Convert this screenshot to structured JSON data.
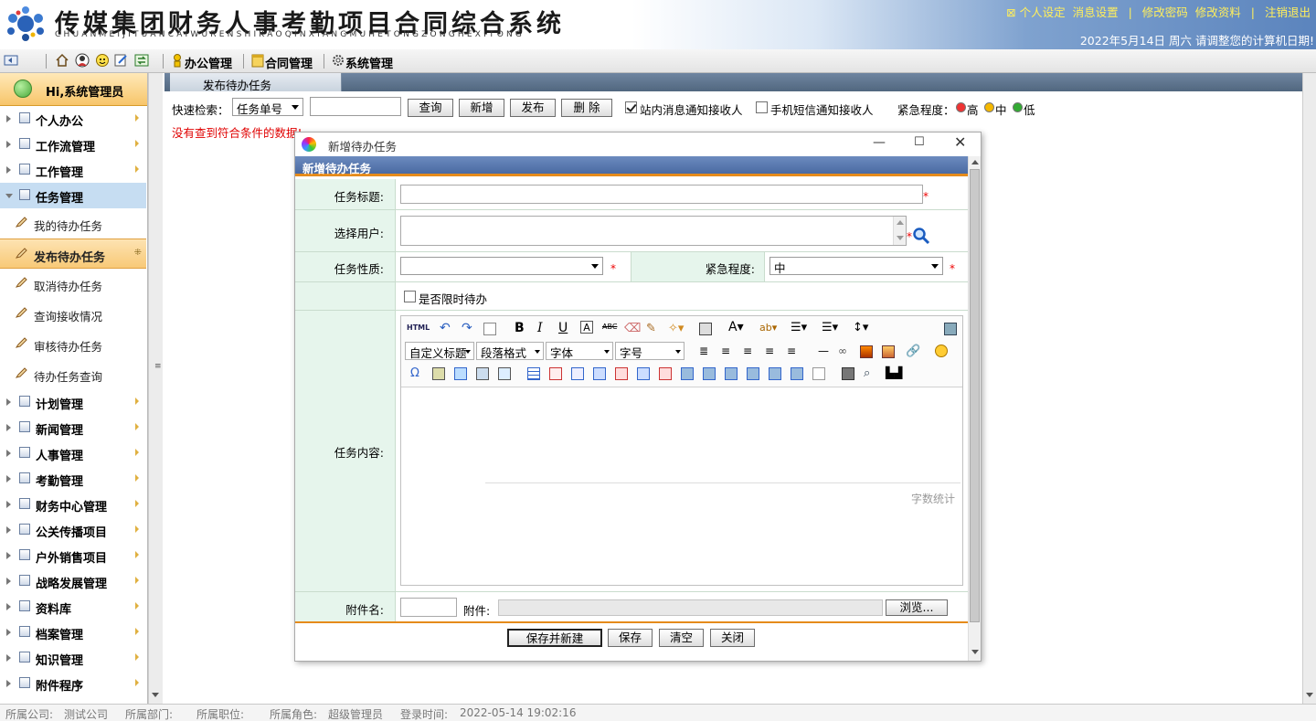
{
  "header": {
    "title": "传媒集团财务人事考勤项目合同综合系统",
    "pinyin": "CHUANMEIJITUANCAIWURENSHIKAOQINXIANGMUHETONGZONGHEXITONG",
    "links": [
      "个人设定",
      "消息设置",
      "修改密码",
      "修改资料",
      "注销退出"
    ],
    "date_line": "2022年5月14日  周六    请调整您的计算机日期!"
  },
  "toolbar": {
    "menus": [
      "办公管理",
      "合同管理",
      "系统管理"
    ]
  },
  "sidebar": {
    "greeting": "Hi,系统管理员",
    "items": [
      {
        "label": "个人办公",
        "type": "group"
      },
      {
        "label": "工作流管理",
        "type": "group"
      },
      {
        "label": "工作管理",
        "type": "group"
      },
      {
        "label": "任务管理",
        "type": "group-open"
      },
      {
        "label": "我的待办任务",
        "type": "sub"
      },
      {
        "label": "发布待办任务",
        "type": "sub-active"
      },
      {
        "label": "取消待办任务",
        "type": "sub"
      },
      {
        "label": "查询接收情况",
        "type": "sub"
      },
      {
        "label": "审核待办任务",
        "type": "sub"
      },
      {
        "label": "待办任务查询",
        "type": "sub"
      },
      {
        "label": "计划管理",
        "type": "group"
      },
      {
        "label": "新闻管理",
        "type": "group"
      },
      {
        "label": "人事管理",
        "type": "group"
      },
      {
        "label": "考勤管理",
        "type": "group"
      },
      {
        "label": "财务中心管理",
        "type": "group"
      },
      {
        "label": "公关传播项目",
        "type": "group"
      },
      {
        "label": "户外销售项目",
        "type": "group"
      },
      {
        "label": "战略发展管理",
        "type": "group"
      },
      {
        "label": "资料库",
        "type": "group"
      },
      {
        "label": "档案管理",
        "type": "group"
      },
      {
        "label": "知识管理",
        "type": "group"
      },
      {
        "label": "附件程序",
        "type": "group"
      }
    ]
  },
  "content": {
    "tab_title": "发布待办任务",
    "search_label": "快速检索：",
    "search_field": "任务单号",
    "search_value": "",
    "buttons": {
      "query": "查询",
      "add": "新增",
      "publish": "发布",
      "delete": "删 除"
    },
    "notify_internal": "站内消息通知接收人",
    "notify_sms": "手机短信通知接收人",
    "urgency_label": "紧急程度：",
    "urgency_levels": [
      {
        "label": "高",
        "color": "#ee3333"
      },
      {
        "label": "中",
        "color": "#f5b800"
      },
      {
        "label": "低",
        "color": "#33aa33"
      }
    ],
    "no_data": "没有查到符合条件的数据!"
  },
  "dialog": {
    "window_title": "新增待办任务",
    "form_title": "新增待办任务",
    "task_title_label": "任务标题:",
    "task_title_value": "",
    "user_label": "选择用户:",
    "nature_label": "任务性质:",
    "nature_value": "",
    "urgency_label": "紧急程度:",
    "urgency_value": "中",
    "limited_label": "是否限时待办",
    "content_label": "任务内容:",
    "editor": {
      "custom_title": "自定义标题",
      "paragraph": "段落格式",
      "font": "字体",
      "size": "字号",
      "word_count": "字数统计"
    },
    "attach_name_label": "附件名:",
    "attach_label": "附件:",
    "browse": "浏览...",
    "buttons": {
      "save_new": "保存并新建",
      "save": "保存",
      "clear": "清空",
      "close": "关闭"
    }
  },
  "status_bar": {
    "company_label": "所属公司:",
    "company": "测试公司",
    "dept_label": "所属部门:",
    "dept": "",
    "position_label": "所属职位:",
    "position": "",
    "role_label": "所属角色:",
    "role": "超级管理员",
    "login_label": "登录时间:",
    "login_time": "2022-05-14 19:02:16"
  },
  "colors": {
    "accent_orange": "#e58b1b",
    "form_header": "#4a6aa2",
    "label_bg": "#e6f5ec",
    "link_yellow": "#ffef5c",
    "error_red": "#e00000"
  }
}
